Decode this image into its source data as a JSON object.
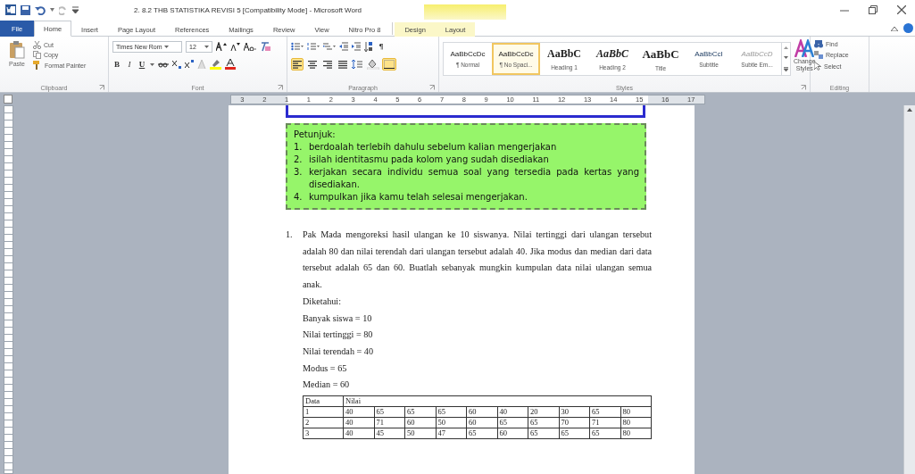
{
  "window": {
    "title": "2. 8.2 THB STATISTIKA REVISI 5 [Compatibility Mode]  -  Microsoft Word"
  },
  "tabs": [
    {
      "label": "File",
      "kind": "file",
      "selected": false
    },
    {
      "label": "Home",
      "kind": "tab",
      "selected": true
    },
    {
      "label": "Insert",
      "kind": "tab",
      "selected": false
    },
    {
      "label": "Page Layout",
      "kind": "tab",
      "selected": false
    },
    {
      "label": "References",
      "kind": "tab",
      "selected": false
    },
    {
      "label": "Mailings",
      "kind": "tab",
      "selected": false
    },
    {
      "label": "Review",
      "kind": "tab",
      "selected": false
    },
    {
      "label": "View",
      "kind": "tab",
      "selected": false
    },
    {
      "label": "Nitro Pro 8",
      "kind": "tab",
      "selected": false
    },
    {
      "label": "Design",
      "kind": "context",
      "selected": false
    },
    {
      "label": "Layout",
      "kind": "context",
      "selected": false
    }
  ],
  "clipboard": {
    "paste": "Paste",
    "cut": "Cut",
    "copy": "Copy",
    "format_painter": "Format Painter",
    "label": "Clipboard"
  },
  "font": {
    "name": "Times New Rom",
    "size": "12",
    "bold": "B",
    "italic": "I",
    "underline": "U",
    "label": "Font"
  },
  "paragraph": {
    "align": [
      {
        "kind": "left",
        "selected": true
      },
      {
        "kind": "center",
        "selected": false
      },
      {
        "kind": "right",
        "selected": false
      },
      {
        "kind": "justify",
        "selected": false
      }
    ],
    "marks": "¶",
    "borders_on": true,
    "label": "Paragraph"
  },
  "styles": {
    "items": [
      {
        "preview": "AaBbCcDc",
        "label": "¶ Normal",
        "kind": "normal",
        "selected": false
      },
      {
        "preview": "AaBbCcDc",
        "label": "¶ No Spaci...",
        "kind": "normal",
        "selected": true
      },
      {
        "preview": "AaBbC",
        "label": "Heading 1",
        "kind": "heading1",
        "selected": false
      },
      {
        "preview": "AaBbC",
        "label": "Heading 2",
        "kind": "heading2",
        "selected": false
      },
      {
        "preview": "AaBbC",
        "label": "Title",
        "kind": "title",
        "selected": false
      },
      {
        "preview": "AaBbCcI",
        "label": "Subtitle",
        "kind": "subtitle",
        "selected": false
      },
      {
        "preview": "AaBbCcD",
        "label": "Subtle Em...",
        "kind": "subtle",
        "selected": false
      }
    ],
    "change": "Change Styles",
    "label": "Styles"
  },
  "editing": {
    "find": "Find",
    "replace": "Replace",
    "select": "Select",
    "label": "Editing"
  },
  "ruler": {
    "labels": [
      "3",
      "2",
      "1",
      "1",
      "2",
      "3",
      "4",
      "5",
      "6",
      "7",
      "8",
      "9",
      "10",
      "11",
      "12",
      "13",
      "14",
      "15",
      "16",
      "17"
    ]
  },
  "instructions": {
    "title": "Petunjuk:",
    "items": [
      {
        "number": "1.",
        "text": "berdoalah terlebih dahulu sebelum kalian mengerjakan"
      },
      {
        "number": "2.",
        "text": "isilah identitasmu pada kolom yang sudah disediakan"
      },
      {
        "number": "3.",
        "text": "kerjakan secara individu semua soal yang tersedia pada kertas yang disediakan."
      },
      {
        "number": "4.",
        "text": "kumpulkan jika kamu telah selesai mengerjakan."
      }
    ]
  },
  "question": {
    "number": "1.",
    "text": "Pak Mada mengoreksi hasil ulangan ke 10 siswanya. Nilai tertinggi dari ulangan tersebut adalah 80 dan nilai terendah dari ulangan tersebut adalah 40. Jika modus dan median dari data tersebut adalah  65 dan 60. Buatlah sebanyak mungkin kumpulan data nilai ulangan semua anak.",
    "lines": [
      "Diketahui:",
      "Banyak siswa = 10",
      "Nilai tertinggi = 80",
      "Nilai terendah = 40",
      "Modus = 65",
      "Median = 60"
    ]
  },
  "table": {
    "columns": [
      "Data",
      "Nilai"
    ],
    "rows": [
      {
        "data": "1",
        "nilai": [
          "40",
          "65",
          "65",
          "65",
          "60",
          "40",
          "20",
          "30",
          "65",
          "80"
        ]
      },
      {
        "data": "2",
        "nilai": [
          "40",
          "71",
          "60",
          "50",
          "60",
          "65",
          "65",
          "70",
          "71",
          "80"
        ]
      },
      {
        "data": "3",
        "nilai": [
          "40",
          "45",
          "50",
          "47",
          "65",
          "60",
          "65",
          "65",
          "65",
          "80"
        ]
      }
    ]
  }
}
